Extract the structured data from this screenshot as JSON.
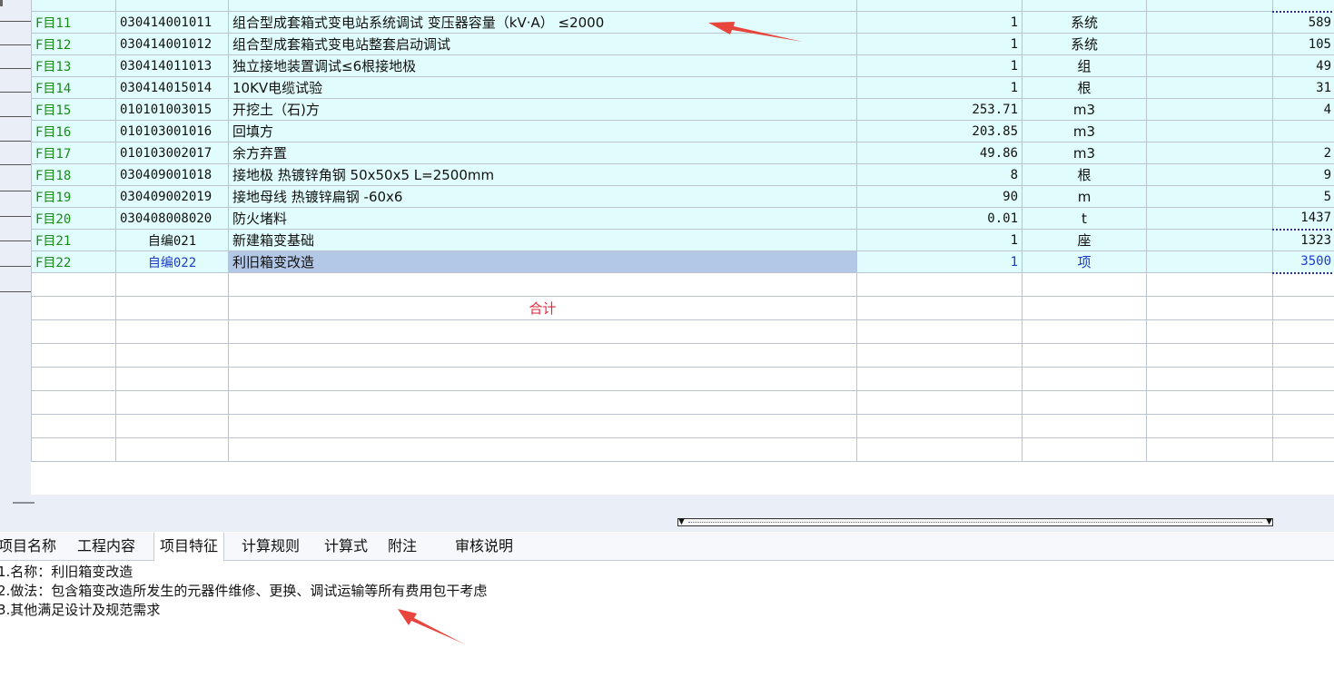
{
  "grid": {
    "rows": [
      {
        "seq": "F目11",
        "code": "030414001011",
        "name": "组合型成套箱式变电站系统调试 变压器容量（kV·A） ≤2000",
        "qty": "1",
        "unit": "系统",
        "price": "589"
      },
      {
        "seq": "F目12",
        "code": "030414001012",
        "name": "组合型成套箱式变电站整套启动调试",
        "qty": "1",
        "unit": "系统",
        "price": "105"
      },
      {
        "seq": "F目13",
        "code": "030414011013",
        "name": "独立接地装置调试≤6根接地极",
        "qty": "1",
        "unit": "组",
        "price": "49"
      },
      {
        "seq": "F目14",
        "code": "030414015014",
        "name": "10KV电缆试验",
        "qty": "1",
        "unit": "根",
        "price": "31"
      },
      {
        "seq": "F目15",
        "code": "010101003015",
        "name": "开挖土（石)方",
        "qty": "253.71",
        "unit": "m3",
        "price": "4"
      },
      {
        "seq": "F目16",
        "code": "010103001016",
        "name": "回填方",
        "qty": "203.85",
        "unit": "m3",
        "price": ""
      },
      {
        "seq": "F目17",
        "code": "010103002017",
        "name": "余方弃置",
        "qty": "49.86",
        "unit": "m3",
        "price": "2"
      },
      {
        "seq": "F目18",
        "code": "030409001018",
        "name": "接地极 热镀锌角钢 50x50x5 L=2500mm",
        "qty": "8",
        "unit": "根",
        "price": "9"
      },
      {
        "seq": "F目19",
        "code": "030409002019",
        "name": "接地母线 热镀锌扁钢 -60x6",
        "qty": "90",
        "unit": "m",
        "price": "5"
      },
      {
        "seq": "F目20",
        "code": "030408008020",
        "name": "防火堵料",
        "qty": "0.01",
        "unit": "t",
        "price": "1437"
      },
      {
        "seq": "F目21",
        "code": "自编021",
        "name": "新建箱变基础",
        "qty": "1",
        "unit": "座",
        "price": "1323"
      },
      {
        "seq": "F目22",
        "code": "自编022",
        "name": "利旧箱变改造",
        "qty": "1",
        "unit": "项",
        "price": "3500"
      }
    ],
    "total_label": "合计"
  },
  "bottom_tabs": [
    "项目名称",
    "工程内容",
    "项目特征",
    "计算规则",
    "计算式",
    "附注",
    "审核说明"
  ],
  "active_tab": "项目特征",
  "features": [
    "1.名称：利旧箱变改造",
    "2.做法：包含箱变改造所发生的元器件维修、更换、调试运输等所有费用包干考虑",
    "3.其他满足设计及规范需求"
  ],
  "colors": {
    "row_bg": "#e1fcfc",
    "seq_text": "#1a8a1a",
    "active_text": "#1a3ccc",
    "total_text": "#e8253a",
    "arrow": "#e8453c"
  }
}
